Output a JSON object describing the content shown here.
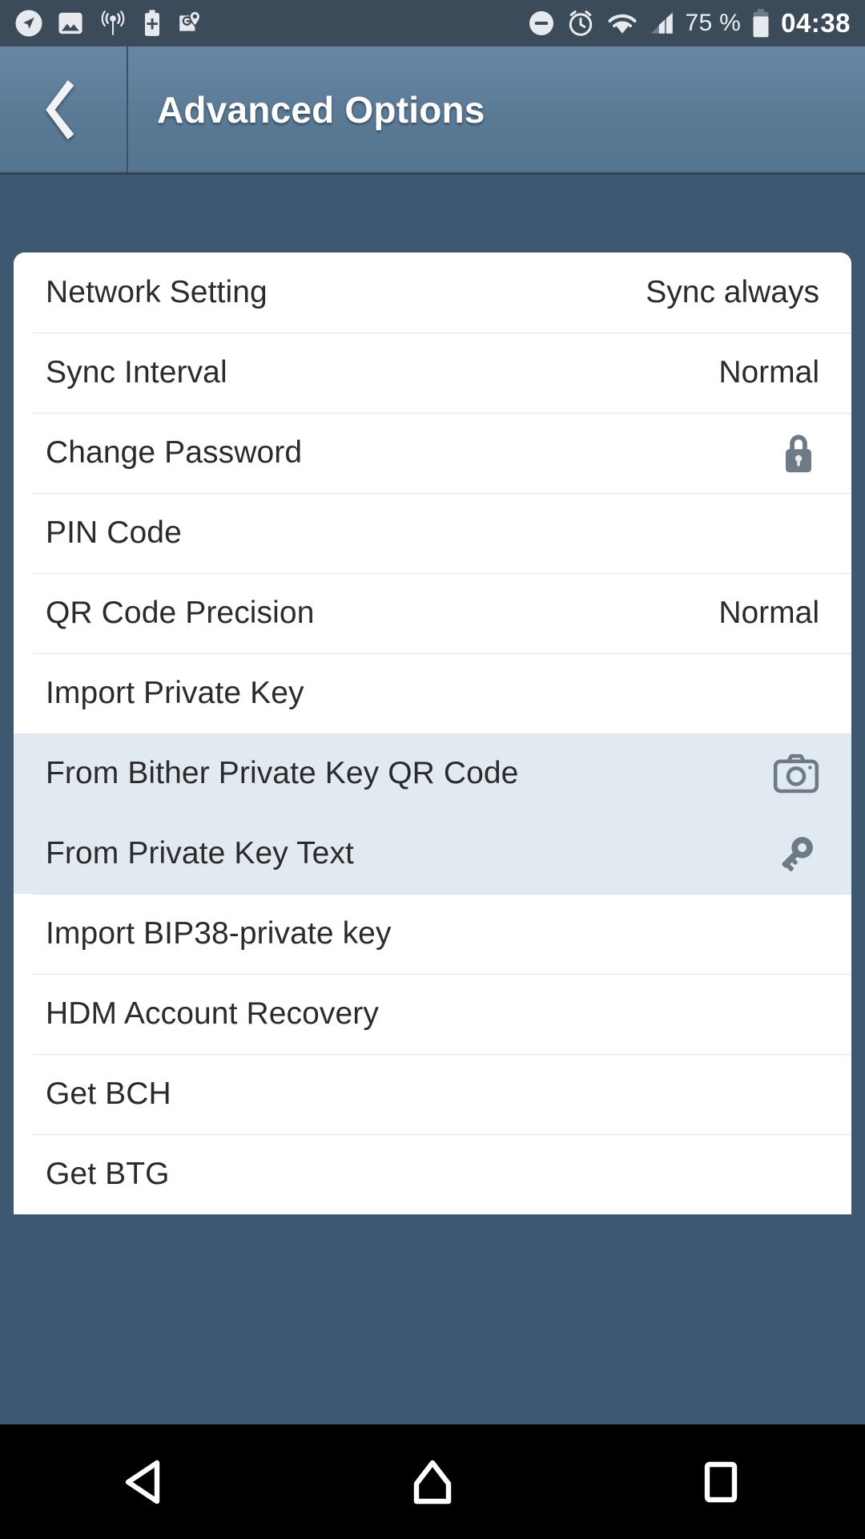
{
  "status_bar": {
    "left_icons": [
      "navigation-arrow-icon",
      "image-icon",
      "signal-tower-icon",
      "battery-plus-icon",
      "google-maps-icon"
    ],
    "right_icons": [
      "do-not-disturb-icon",
      "alarm-clock-icon",
      "wifi-icon",
      "cellular-signal-icon"
    ],
    "battery_percent": "75 %",
    "clock": "04:38",
    "background_color": "#3b4b59"
  },
  "action_bar": {
    "back_label": "back",
    "title": "Advanced Options",
    "background_color": "#5a7a96"
  },
  "page": {
    "background_color": "#3e5871",
    "card_background": "#ffffff",
    "highlight_color": "#e1eaf0",
    "icon_color": "#6e7a85"
  },
  "settings_list": [
    {
      "label": "Network Setting",
      "value": "Sync always",
      "icon": null,
      "highlighted": false
    },
    {
      "label": "Sync Interval",
      "value": "Normal",
      "icon": null,
      "highlighted": false
    },
    {
      "label": "Change Password",
      "value": "",
      "icon": "lock-icon",
      "highlighted": false
    },
    {
      "label": "PIN Code",
      "value": "",
      "icon": null,
      "highlighted": false
    },
    {
      "label": "QR Code Precision",
      "value": "Normal",
      "icon": null,
      "highlighted": false
    },
    {
      "label": "Import Private Key",
      "value": "",
      "icon": null,
      "highlighted": false
    },
    {
      "label": "From Bither Private Key QR Code",
      "value": "",
      "icon": "camera-icon",
      "highlighted": true
    },
    {
      "label": "From Private Key Text",
      "value": "",
      "icon": "key-icon",
      "highlighted": true
    },
    {
      "label": "Import BIP38-private key",
      "value": "",
      "icon": null,
      "highlighted": false
    },
    {
      "label": "HDM Account Recovery",
      "value": "",
      "icon": null,
      "highlighted": false
    },
    {
      "label": "Get BCH",
      "value": "",
      "icon": null,
      "highlighted": false
    },
    {
      "label": "Get BTG",
      "value": "",
      "icon": null,
      "highlighted": false
    }
  ],
  "nav_bar": {
    "buttons": [
      "back-triangle-icon",
      "home-icon",
      "recents-square-icon"
    ],
    "background_color": "#000000"
  }
}
